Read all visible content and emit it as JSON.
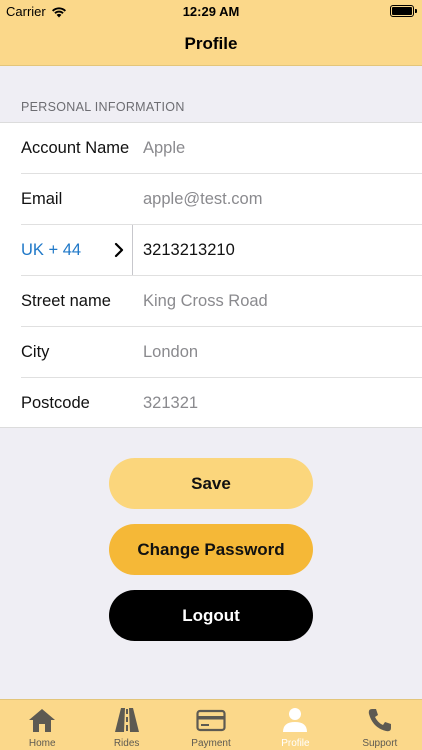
{
  "status_bar": {
    "carrier": "Carrier",
    "time": "12:29 AM"
  },
  "nav": {
    "title": "Profile"
  },
  "section": {
    "header": "PERSONAL INFORMATION"
  },
  "form": {
    "account_name": {
      "label": "Account Name",
      "value": "Apple"
    },
    "email": {
      "label": "Email",
      "value": "apple@test.com"
    },
    "phone": {
      "country_code": "UK + 44",
      "value": "3213213210"
    },
    "street": {
      "label": "Street name",
      "value": "King Cross Road"
    },
    "city": {
      "label": "City",
      "value": "London"
    },
    "postcode": {
      "label": "Postcode",
      "value": "321321"
    }
  },
  "buttons": {
    "save": "Save",
    "change_password": "Change Password",
    "logout": "Logout"
  },
  "tabs": [
    {
      "label": "Home",
      "icon": "house-icon",
      "active": false
    },
    {
      "label": "Rides",
      "icon": "road-icon",
      "active": false
    },
    {
      "label": "Payment",
      "icon": "credit-card-icon",
      "active": false
    },
    {
      "label": "Profile",
      "icon": "person-icon",
      "active": true
    },
    {
      "label": "Support",
      "icon": "phone-icon",
      "active": false
    }
  ],
  "colors": {
    "accent": "#fbd88a",
    "save_button": "#fbd67c",
    "change_password_button": "#f5b837",
    "logout_button": "#000000",
    "link": "#1f78c8"
  }
}
